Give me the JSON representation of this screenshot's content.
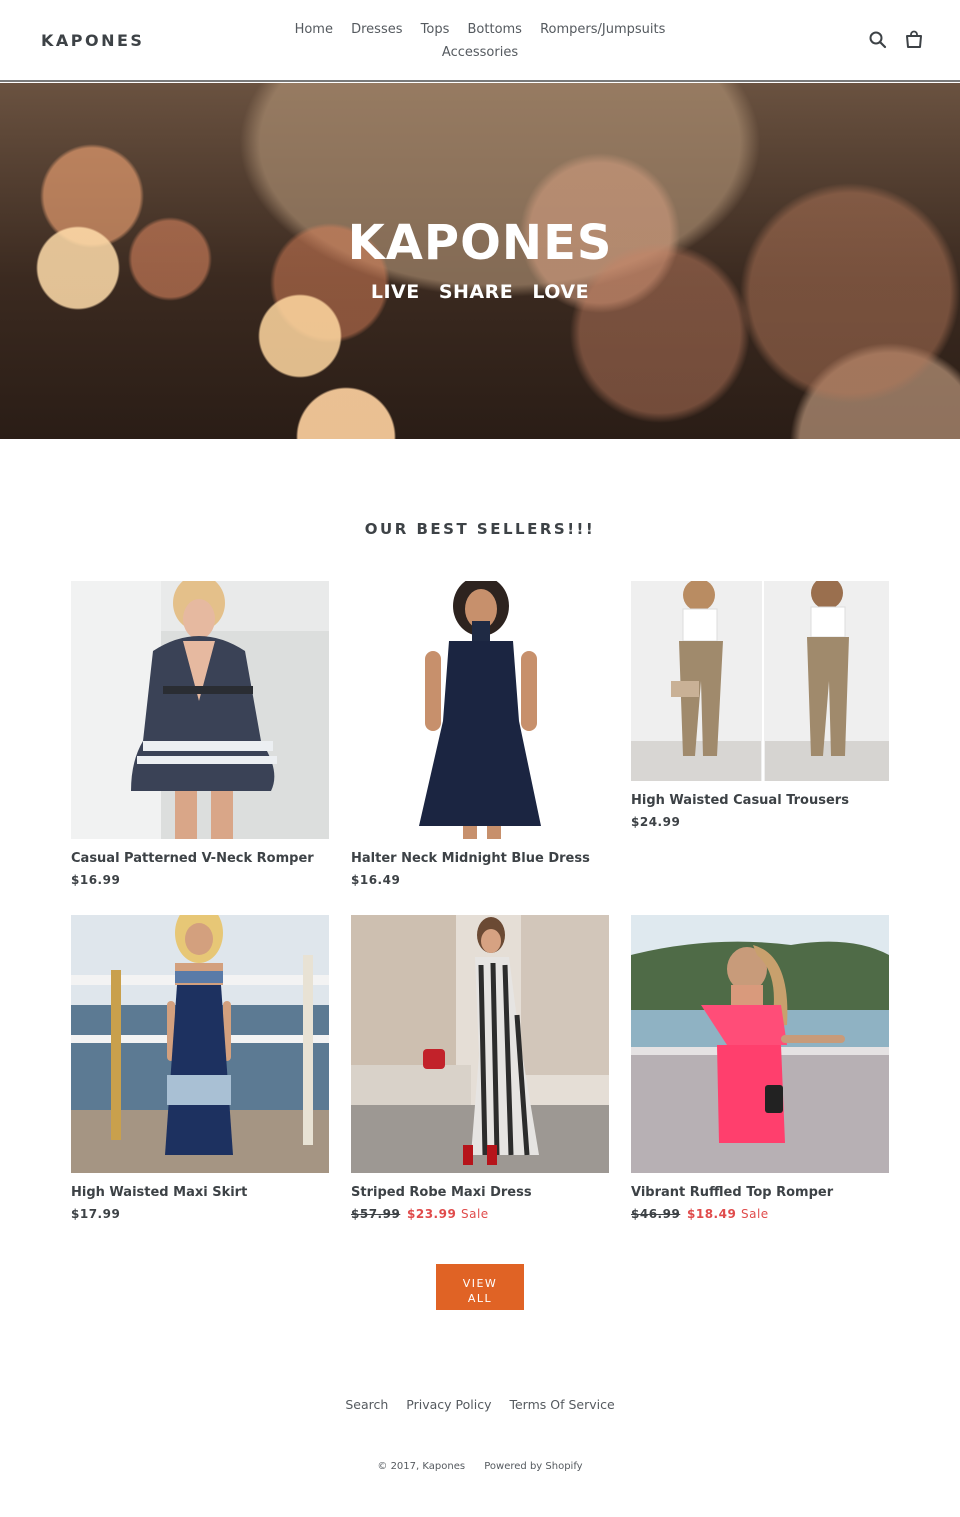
{
  "header": {
    "logo": "KAPONES",
    "nav": [
      "Home",
      "Dresses",
      "Tops",
      "Bottoms",
      "Rompers/Jumpsuits",
      "Accessories"
    ],
    "icons": [
      "search-icon",
      "cart-icon"
    ]
  },
  "hero": {
    "title": "KAPONES",
    "tagline": "LIVE SHARE LOVE"
  },
  "featured": {
    "title": "OUR BEST SELLERS!!!",
    "products": [
      {
        "name": "Casual Patterned V-Neck Romper",
        "price": "$16.99",
        "old_price": "",
        "sale_price": "",
        "sale_label": ""
      },
      {
        "name": "Halter Neck Midnight Blue Dress",
        "price": "$16.49",
        "old_price": "",
        "sale_price": "",
        "sale_label": ""
      },
      {
        "name": "High Waisted Casual Trousers",
        "price": "$24.99",
        "old_price": "",
        "sale_price": "",
        "sale_label": ""
      },
      {
        "name": "High Waisted Maxi Skirt",
        "price": "$17.99",
        "old_price": "",
        "sale_price": "",
        "sale_label": ""
      },
      {
        "name": "Striped Robe Maxi Dress",
        "price": "",
        "old_price": "$57.99",
        "sale_price": "$23.99",
        "sale_label": "Sale"
      },
      {
        "name": "Vibrant Ruffled Top Romper",
        "price": "",
        "old_price": "$46.99",
        "sale_price": "$18.49",
        "sale_label": "Sale"
      }
    ],
    "view_all_line1": "VIEW",
    "view_all_line2": "ALL"
  },
  "footer": {
    "links": [
      "Search",
      "Privacy Policy",
      "Terms Of Service"
    ],
    "copyright": "© 2017, Kapones",
    "powered": "Powered by Shopify"
  },
  "colors": {
    "accent": "#e06325",
    "sale": "#e04b4b",
    "text": "#3d4246"
  }
}
